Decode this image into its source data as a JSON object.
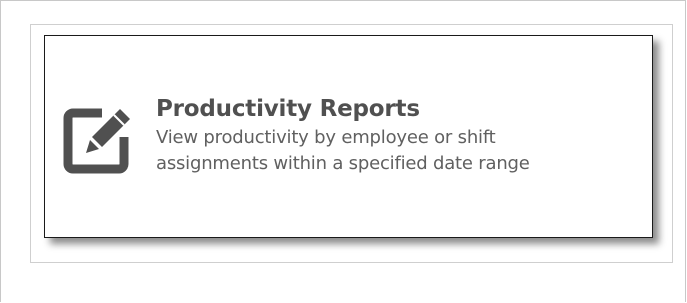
{
  "report_card": {
    "title": "Productivity Reports",
    "description_line1": "View productivity by employee or shift",
    "description_line2": "assignments within a specified date range",
    "icon": "edit-icon"
  },
  "colors": {
    "icon": "#505050",
    "title": "#505050",
    "description": "#606060",
    "card_border": "#1a1a1a"
  }
}
